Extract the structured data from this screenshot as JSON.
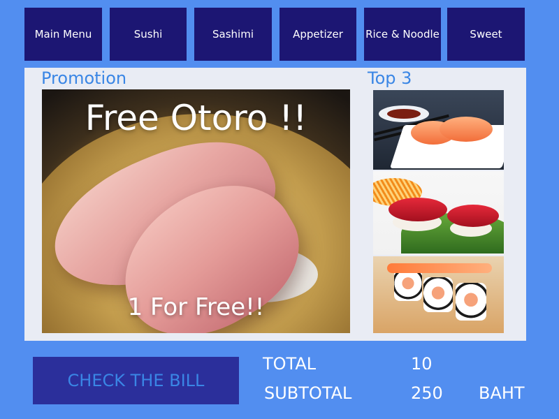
{
  "nav": {
    "items": [
      {
        "label": "Main Menu"
      },
      {
        "label": "Sushi"
      },
      {
        "label": "Sashimi"
      },
      {
        "label": "Appetizer"
      },
      {
        "label": "Rice & Noodle"
      },
      {
        "label": "Sweet"
      }
    ]
  },
  "promotion": {
    "section_title": "Promotion",
    "headline": "Free Otoro !!",
    "subline": "1 For Free!!"
  },
  "top3": {
    "section_title": "Top 3",
    "items": [
      {
        "icon": "salmon-nigiri-image"
      },
      {
        "icon": "tuna-nigiri-image"
      },
      {
        "icon": "salmon-roll-image"
      }
    ]
  },
  "footer": {
    "bill_button_label": "CHECK THE BILL",
    "total_label": "TOTAL",
    "total_value": "10",
    "subtotal_label": "SUBTOTAL",
    "subtotal_value": "250",
    "currency": "BAHT"
  },
  "colors": {
    "background": "#528ef0",
    "nav_button": "#1c1673",
    "accent_text": "#3a86e5",
    "bill_button": "#2b2f9b"
  }
}
